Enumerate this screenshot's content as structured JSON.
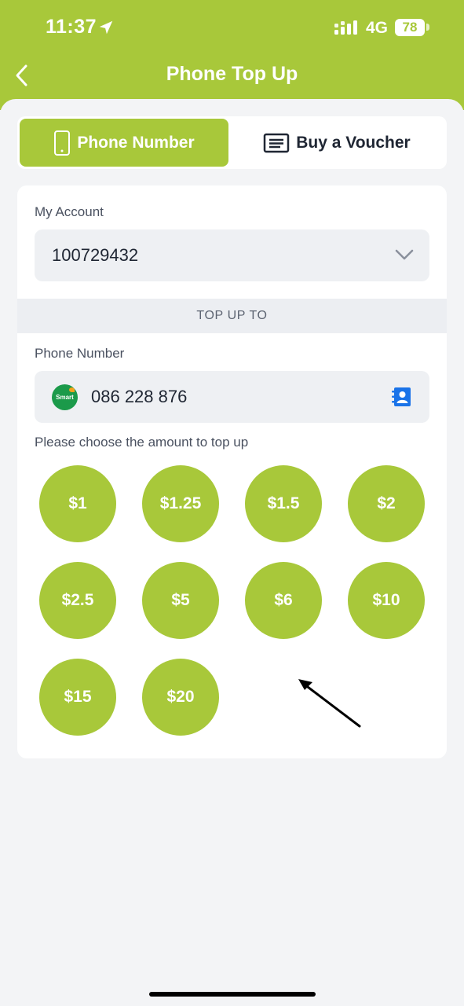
{
  "status_bar": {
    "time": "11:37",
    "network": "4G",
    "battery": "78"
  },
  "header": {
    "title": "Phone Top Up",
    "back_icon": "chevron-left-icon",
    "color": "#a8c83a"
  },
  "tabs": [
    {
      "label": "Phone Number",
      "icon": "mobile-phone-icon",
      "active": true
    },
    {
      "label": "Buy a Voucher",
      "icon": "voucher-icon",
      "active": false
    }
  ],
  "account": {
    "label": "My Account",
    "value": "100729432",
    "icon": "chevron-down-icon"
  },
  "section": {
    "divider_label": "TOP UP TO"
  },
  "phone": {
    "label": "Phone Number",
    "carrier": "Smart",
    "value": "086 228 876",
    "contact_icon": "contact-book-icon"
  },
  "amounts": {
    "prompt": "Please choose the amount to top up",
    "options": [
      "$1",
      "$1.25",
      "$1.5",
      "$2",
      "$2.5",
      "$5",
      "$6",
      "$10",
      "$15",
      "$20"
    ]
  }
}
